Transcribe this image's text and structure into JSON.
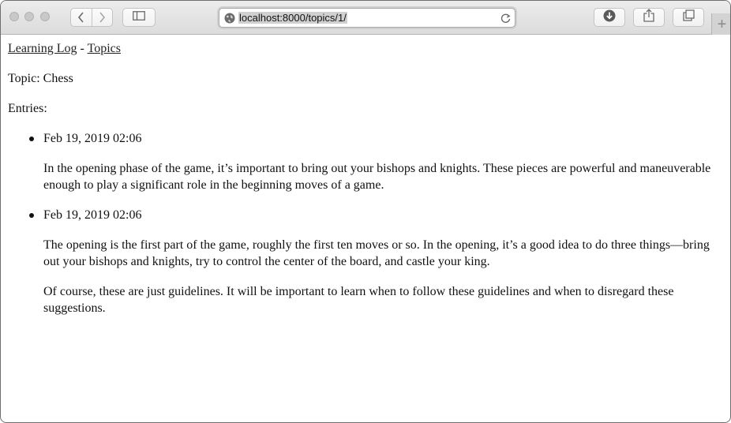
{
  "browser": {
    "url": "localhost:8000/topics/1/",
    "new_tab_symbol": "+",
    "icons": [
      "back-icon",
      "forward-icon",
      "sidebar-icon",
      "globe-icon",
      "reload-icon",
      "download-icon",
      "share-icon",
      "tabs-icon"
    ]
  },
  "nav": {
    "home_link": "Learning Log",
    "separator": "-",
    "topics_link": "Topics"
  },
  "page": {
    "topic_heading": "Topic: Chess",
    "entries_label": "Entries:"
  },
  "entries": [
    {
      "date": "Feb 19, 2019 02:06",
      "paragraph_1": "In the opening phase of the game, it’s important to bring out your bishops and knights. These pieces are powerful and maneuverable enough to play a significant role in the beginning moves of a game."
    },
    {
      "date": "Feb 19, 2019 02:06",
      "paragraph_1": "The opening is the first part of the game, roughly the first ten moves or so. In the opening, it’s a good idea to do three things—bring out your bishops and knights, try to control the center of the board, and castle your king.",
      "paragraph_2": "Of course, these are just guidelines. It will be important to learn when to follow these guidelines and when to disregard these suggestions."
    }
  ]
}
